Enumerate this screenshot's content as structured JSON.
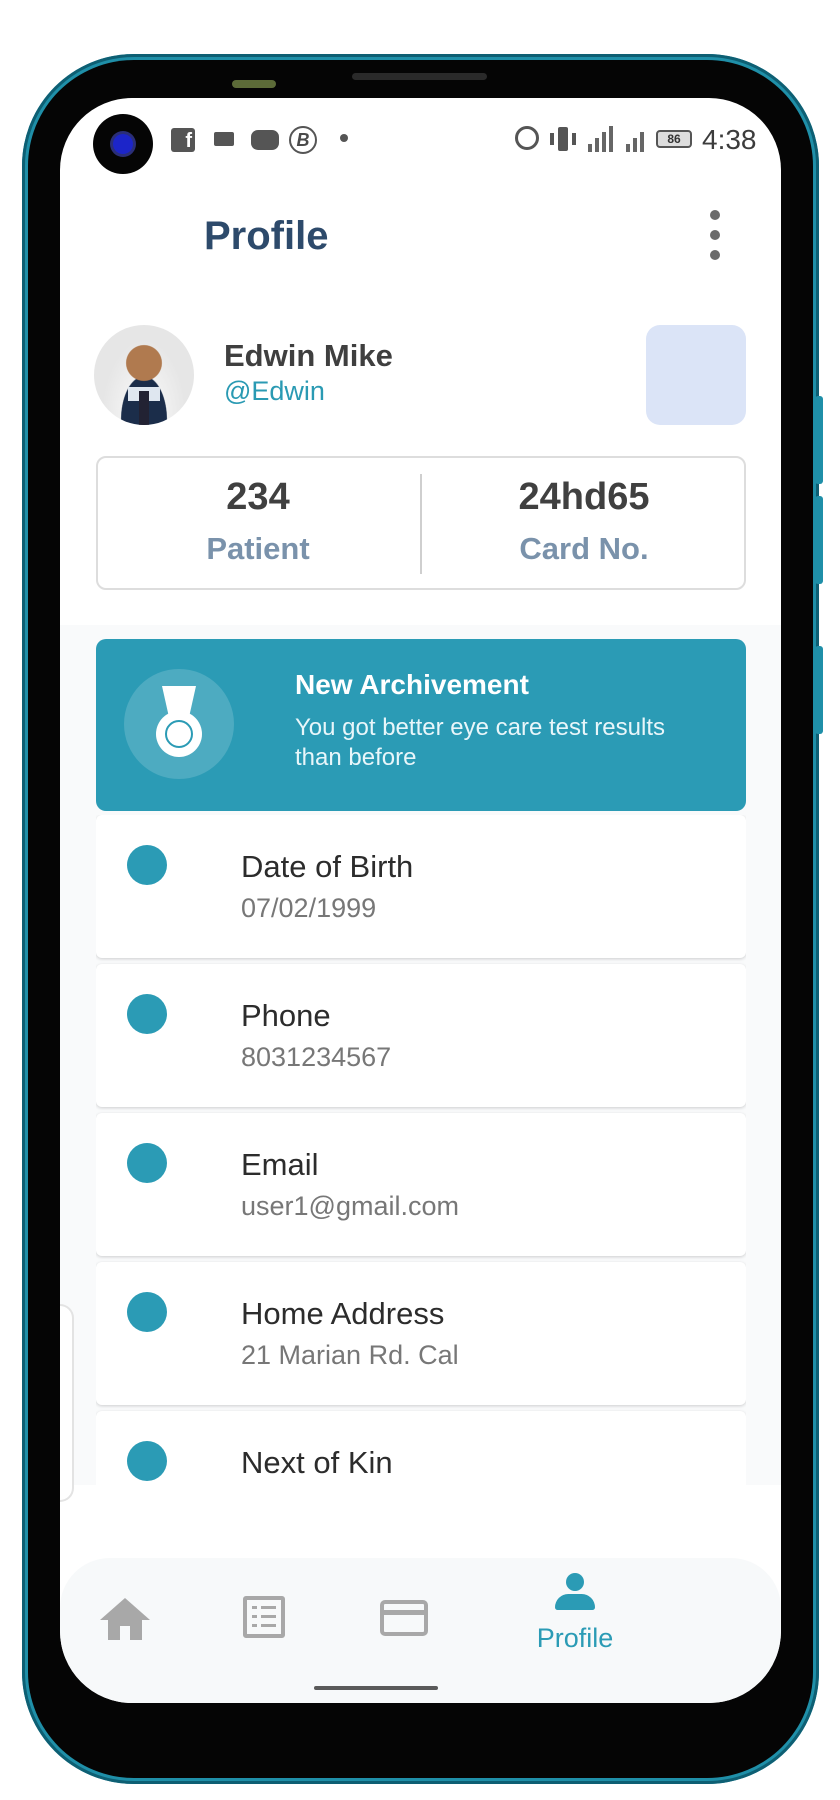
{
  "status_bar": {
    "time": "4:38",
    "battery": "86",
    "icons": [
      "facebook-icon",
      "message-icon",
      "game-controller-icon",
      "b-circle-icon",
      "dot-icon",
      "alarm-icon",
      "vibrate-icon",
      "signal-4g-icon",
      "signal-icon",
      "battery-icon"
    ]
  },
  "app_bar": {
    "title": "Profile",
    "menu_icon": "more-vertical-icon"
  },
  "profile": {
    "name": "Edwin Mike",
    "handle": "@Edwin"
  },
  "stats": [
    {
      "value": "234",
      "label": "Patient"
    },
    {
      "value": "24hd65",
      "label": "Card No."
    }
  ],
  "achievement": {
    "icon": "medal-icon",
    "title": "New Archivement",
    "text": "You got better eye care test results than before"
  },
  "info_items": [
    {
      "label": "Date of Birth",
      "value": "07/02/1999"
    },
    {
      "label": "Phone",
      "value": "8031234567"
    },
    {
      "label": "Email",
      "value": "user1@gmail.com"
    },
    {
      "label": "Home Address",
      "value": "21 Marian Rd. Cal"
    },
    {
      "label": "Next of Kin",
      "value": ""
    }
  ],
  "bottom_nav": {
    "items": [
      {
        "icon": "home-icon",
        "label": ""
      },
      {
        "icon": "list-icon",
        "label": ""
      },
      {
        "icon": "card-icon",
        "label": ""
      },
      {
        "icon": "person-icon",
        "label": "Profile",
        "active": true
      }
    ]
  },
  "colors": {
    "accent": "#2b9bb5",
    "title": "#2d4a6b",
    "stat_label": "#7a92ab",
    "tile": "#dbe4f7"
  }
}
